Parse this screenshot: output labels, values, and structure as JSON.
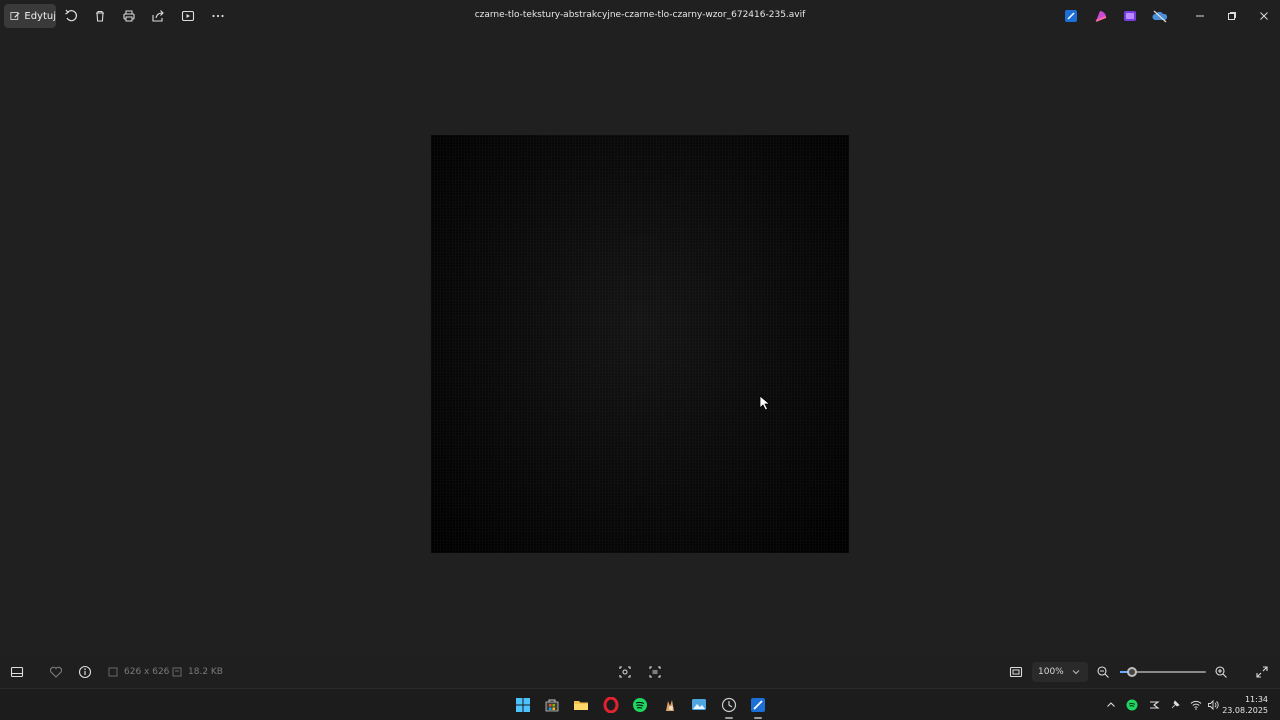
{
  "titlebar": {
    "edit_label": "Edytuj",
    "title": "czarne-tlo-tekstury-abstrakcyjne-czarne-tlo-czarny-wzor_672416-235.avif",
    "tools": [
      "rotate-icon",
      "delete-icon",
      "print-icon",
      "share-icon",
      "slideshow-icon",
      "more-icon"
    ],
    "app_icons": [
      "designer-icon",
      "clipchamp-icon",
      "video-editor-icon",
      "onedrive-icon"
    ],
    "window_controls": [
      "minimize-icon",
      "restore-icon",
      "close-icon"
    ]
  },
  "statusbar": {
    "dimensions": "626 x 626",
    "file_size": "18.2 KB",
    "zoom": "100%",
    "zoom_level": 0.14
  },
  "taskbar": {
    "apps": [
      "windows-start-icon",
      "store-icon",
      "file-explorer-icon",
      "opera-icon",
      "spotify-icon",
      "app-icon",
      "photos-icon",
      "clock-app-icon",
      "designer-app-icon"
    ],
    "time": "11:34",
    "date": "23.08.2025"
  },
  "colors": {
    "accent": "#6aa9ff",
    "background": "#202020",
    "spotify": "#1ed760",
    "opera": "#e0232e"
  }
}
